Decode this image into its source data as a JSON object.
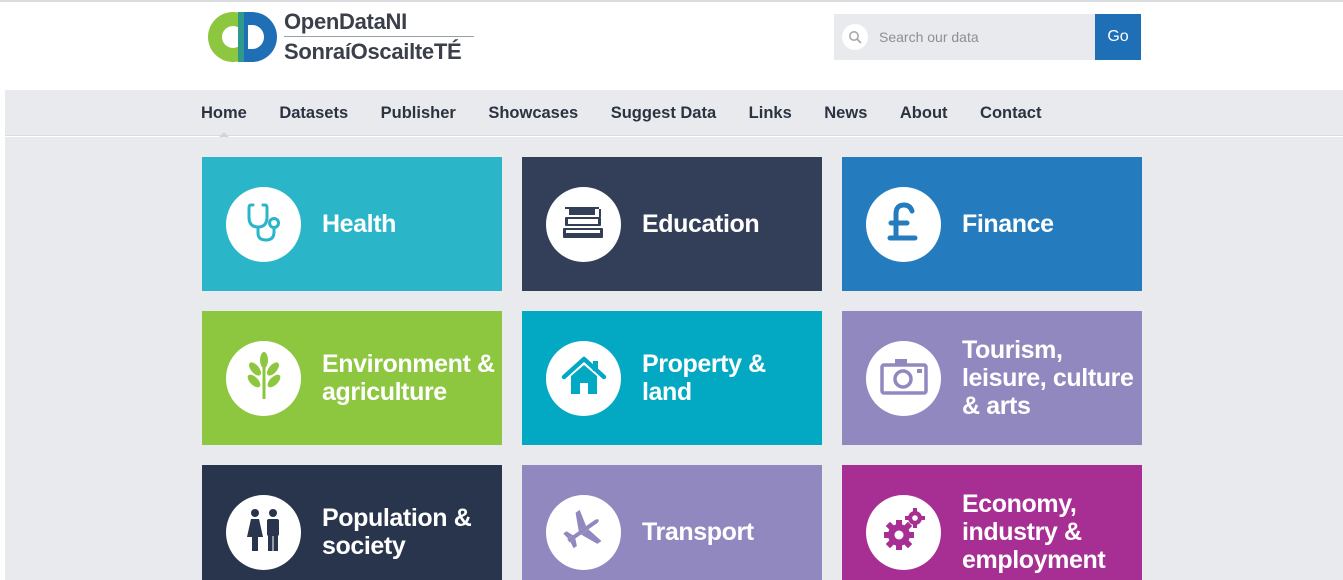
{
  "logo": {
    "line1": "OpenDataNI",
    "line2": "SonraíOscailteTÉ"
  },
  "search": {
    "placeholder": "Search our data",
    "button_label": "Go"
  },
  "nav": {
    "items": [
      {
        "label": "Home"
      },
      {
        "label": "Datasets"
      },
      {
        "label": "Publisher"
      },
      {
        "label": "Showcases"
      },
      {
        "label": "Suggest Data"
      },
      {
        "label": "Links"
      },
      {
        "label": "News"
      },
      {
        "label": "About"
      },
      {
        "label": "Contact"
      }
    ]
  },
  "tiles": [
    {
      "label": "Health",
      "color": "#2bb5c9",
      "icon": "stethoscope-icon"
    },
    {
      "label": "Education",
      "color": "#333f58",
      "icon": "books-icon"
    },
    {
      "label": "Finance",
      "color": "#247bbe",
      "icon": "pound-icon"
    },
    {
      "label": "Environment & agriculture",
      "color": "#8dc63f",
      "icon": "plant-icon"
    },
    {
      "label": "Property & land",
      "color": "#03a9c2",
      "icon": "house-icon"
    },
    {
      "label": "Tourism, leisure, culture & arts",
      "color": "#9288c0",
      "icon": "camera-icon"
    },
    {
      "label": "Population & society",
      "color": "#28354c",
      "icon": "people-icon"
    },
    {
      "label": "Transport",
      "color": "#9288c0",
      "icon": "airplane-icon"
    },
    {
      "label": "Economy, industry & employment",
      "color": "#a72e92",
      "icon": "gears-icon"
    }
  ],
  "colors": {
    "brand_blue": "#1e6fb6",
    "brand_green": "#8dc63f",
    "nav_bg": "#e9eaed"
  }
}
